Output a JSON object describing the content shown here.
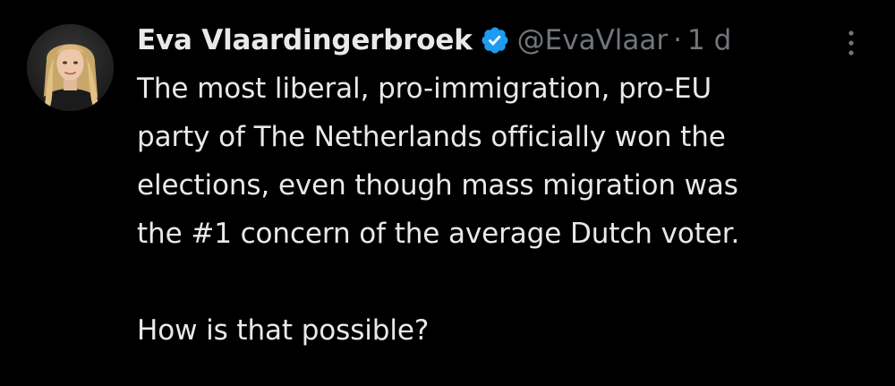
{
  "author": {
    "name": "Eva Vlaardingerbroek",
    "handle": "@EvaVlaar",
    "separator": "·",
    "time": "1 d",
    "verified": true
  },
  "avatar": {
    "description_icon": "profile-photo"
  },
  "tweet": {
    "lines": [
      "The most liberal, pro-immigration, pro-EU",
      "party of The Netherlands officially won the",
      "elections, even though mass migration was",
      "the #1 concern of the average Dutch voter."
    ],
    "question": "How is that possible?"
  },
  "colors": {
    "background": "#000000",
    "text": "#e7e9ea",
    "secondary": "#71767b",
    "verified_blue": "#1d9bf0"
  },
  "icons": {
    "verified": "verified-badge-icon",
    "more": "more-options-icon"
  }
}
